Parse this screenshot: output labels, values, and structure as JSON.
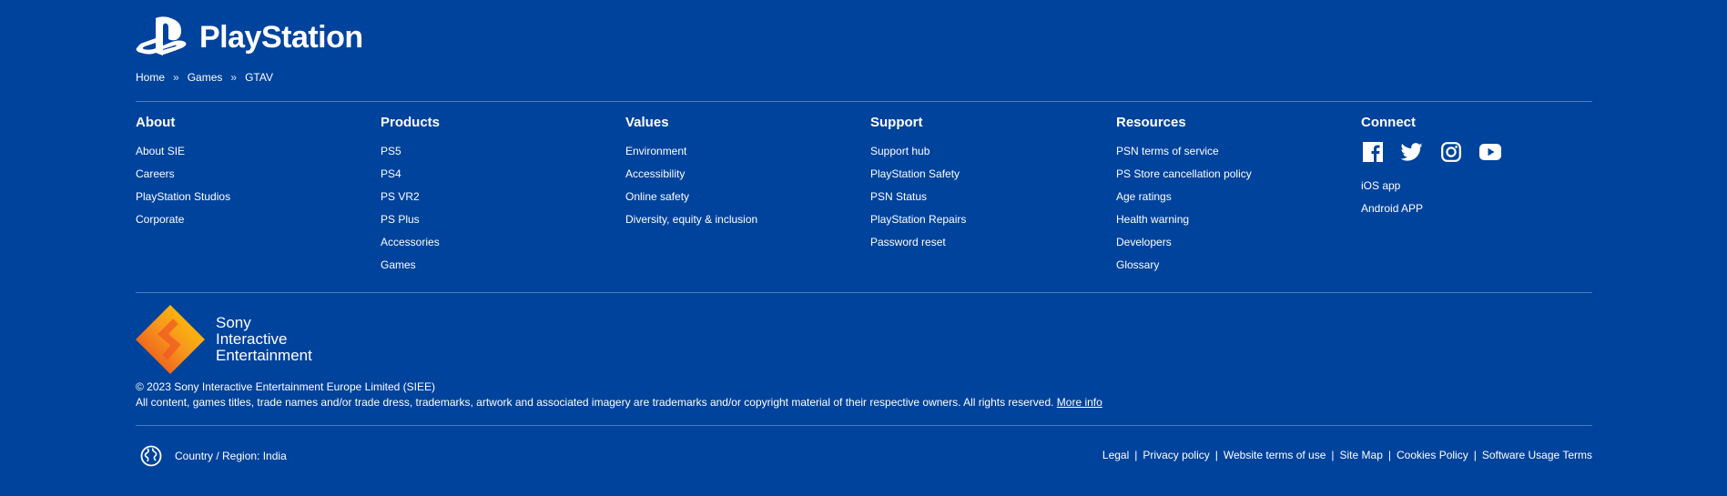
{
  "brand": {
    "name": "PlayStation"
  },
  "breadcrumb": [
    "Home",
    "Games",
    "GTAV"
  ],
  "columns": [
    {
      "title": "About",
      "links": [
        "About SIE",
        "Careers",
        "PlayStation Studios",
        "Corporate"
      ]
    },
    {
      "title": "Products",
      "links": [
        "PS5",
        "PS4",
        "PS VR2",
        "PS Plus",
        "Accessories",
        "Games"
      ]
    },
    {
      "title": "Values",
      "links": [
        "Environment",
        "Accessibility",
        "Online safety",
        "Diversity, equity & inclusion"
      ]
    },
    {
      "title": "Support",
      "links": [
        "Support hub",
        "PlayStation Safety",
        "PSN Status",
        "PlayStation Repairs",
        "Password reset"
      ]
    },
    {
      "title": "Resources",
      "links": [
        "PSN terms of service",
        "PS Store cancellation policy",
        "Age ratings",
        "Health warning",
        "Developers",
        "Glossary"
      ]
    }
  ],
  "connect": {
    "title": "Connect",
    "social_icons": [
      "facebook-icon",
      "twitter-icon",
      "instagram-icon",
      "youtube-icon"
    ],
    "apps": [
      "iOS app",
      "Android APP"
    ]
  },
  "sie": {
    "line1": "Sony",
    "line2": "Interactive",
    "line3": "Entertainment"
  },
  "legal": {
    "copyright": "© 2023 Sony Interactive Entertainment Europe Limited (SIEE)",
    "notice": "All content, games titles, trade names and/or trade dress, trademarks, artwork and associated imagery are trademarks and/or copyright material of their respective owners. All rights reserved.",
    "more_info": "More info"
  },
  "region": {
    "label": "Country / Region: India"
  },
  "footer_links": [
    "Legal",
    "Privacy policy",
    "Website terms of use",
    "Site Map",
    "Cookies Policy",
    "Software Usage Terms"
  ],
  "colors": {
    "background": "#00439c",
    "text": "#ffffff"
  }
}
